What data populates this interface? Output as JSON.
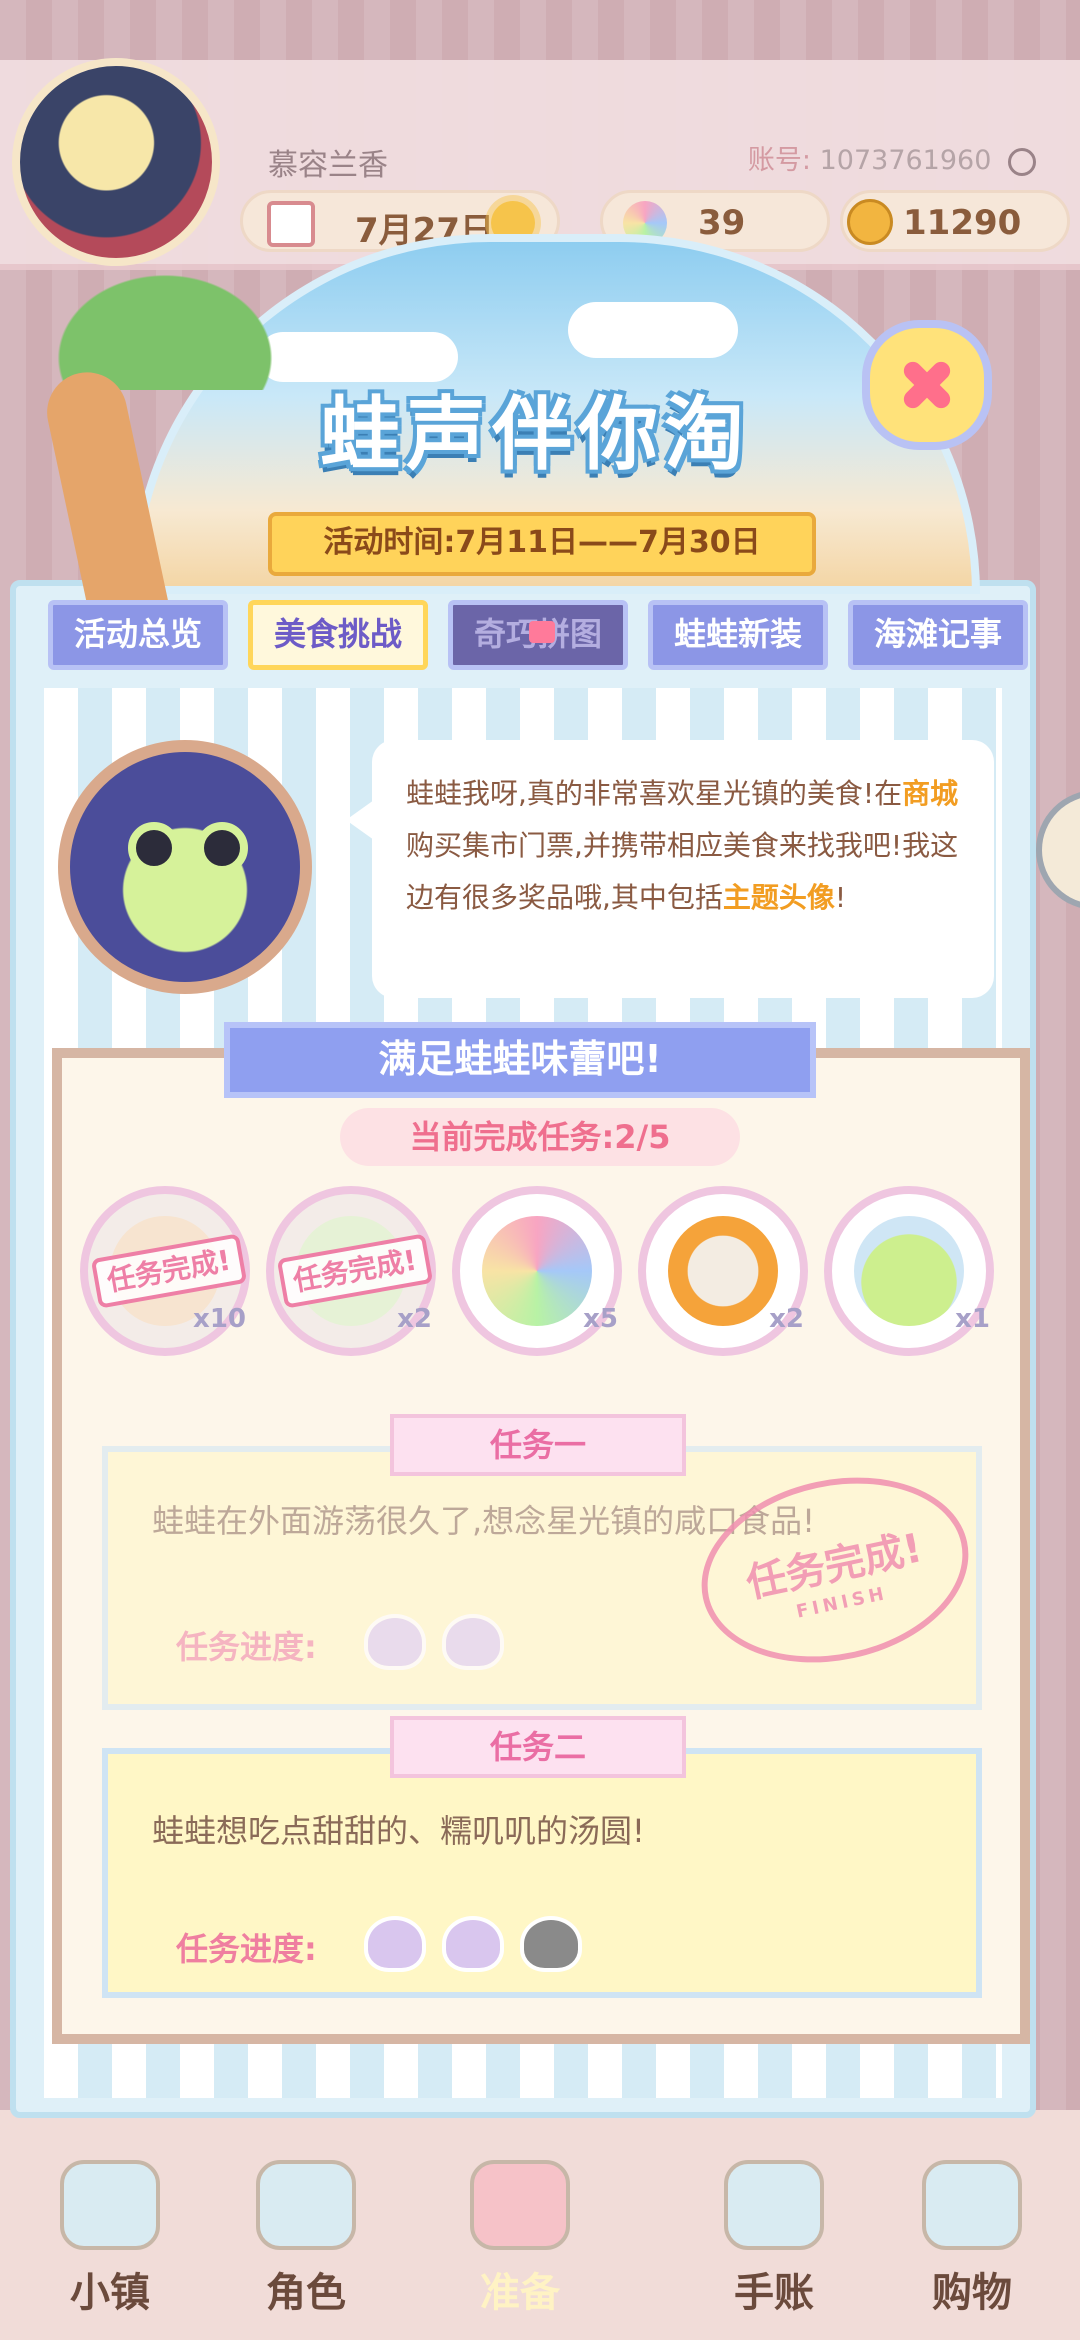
{
  "hud": {
    "player_name": "慕容兰香",
    "account_label": "账号:",
    "account_id": "1073761960",
    "date": "7月27日",
    "gems": "39",
    "coins": "11290"
  },
  "event": {
    "title": "蛙声伴你淘",
    "period": "活动时间:7月11日——7月30日"
  },
  "tabs": [
    {
      "label": "活动总览",
      "state": "normal"
    },
    {
      "label": "美食挑战",
      "state": "active"
    },
    {
      "label": "奇巧拼图",
      "state": "locked"
    },
    {
      "label": "蛙蛙新装",
      "state": "normal"
    },
    {
      "label": "海滩记事",
      "state": "normal"
    }
  ],
  "speech": {
    "part1": "蛙蛙我呀,真的非常喜欢星光镇的美食!在",
    "highlight1": "商城",
    "part2": "购买集市门票,并携带相应美食来找我吧!我这边有很多奖品哦,其中包括",
    "highlight2": "主题头像",
    "part3": "!"
  },
  "panel": {
    "title": "满足蛙蛙味蕾吧!",
    "progress_text": "当前完成任务:2/5"
  },
  "rewards": [
    {
      "name": "task-complete-stamp",
      "stamp": "任务完成!",
      "qty": "x10",
      "done": true
    },
    {
      "name": "task-complete-stamp",
      "stamp": "任务完成!",
      "qty": "x2",
      "done": true
    },
    {
      "name": "rainbow-petal",
      "qty": "x5",
      "done": false
    },
    {
      "name": "food-bowl",
      "qty": "x2",
      "done": false
    },
    {
      "name": "frog-avatar",
      "qty": "x1",
      "done": false
    }
  ],
  "tasks": [
    {
      "header": "任务一",
      "text": "蛙蛙在外面游荡很久了,想念星光镇的咸口食品!",
      "progress_label": "任务进度:",
      "shells_filled": 2,
      "shells_total": 2,
      "stamp": "任务完成!",
      "stamp_sub": "FINISH"
    },
    {
      "header": "任务二",
      "text": "蛙蛙想吃点甜甜的、糯叽叽的汤圆!",
      "progress_label": "任务进度:",
      "shells_filled": 2,
      "shells_total": 3
    }
  ],
  "bottom_nav": [
    {
      "label": "小镇"
    },
    {
      "label": "角色"
    },
    {
      "label": "准备"
    },
    {
      "label": "手账"
    },
    {
      "label": "购物"
    }
  ],
  "colors": {
    "tab_active_text": "#6d5bc7",
    "highlight": "#f29d22",
    "task_pink": "#ea6ea4",
    "close_x": "#ff6f8b"
  }
}
